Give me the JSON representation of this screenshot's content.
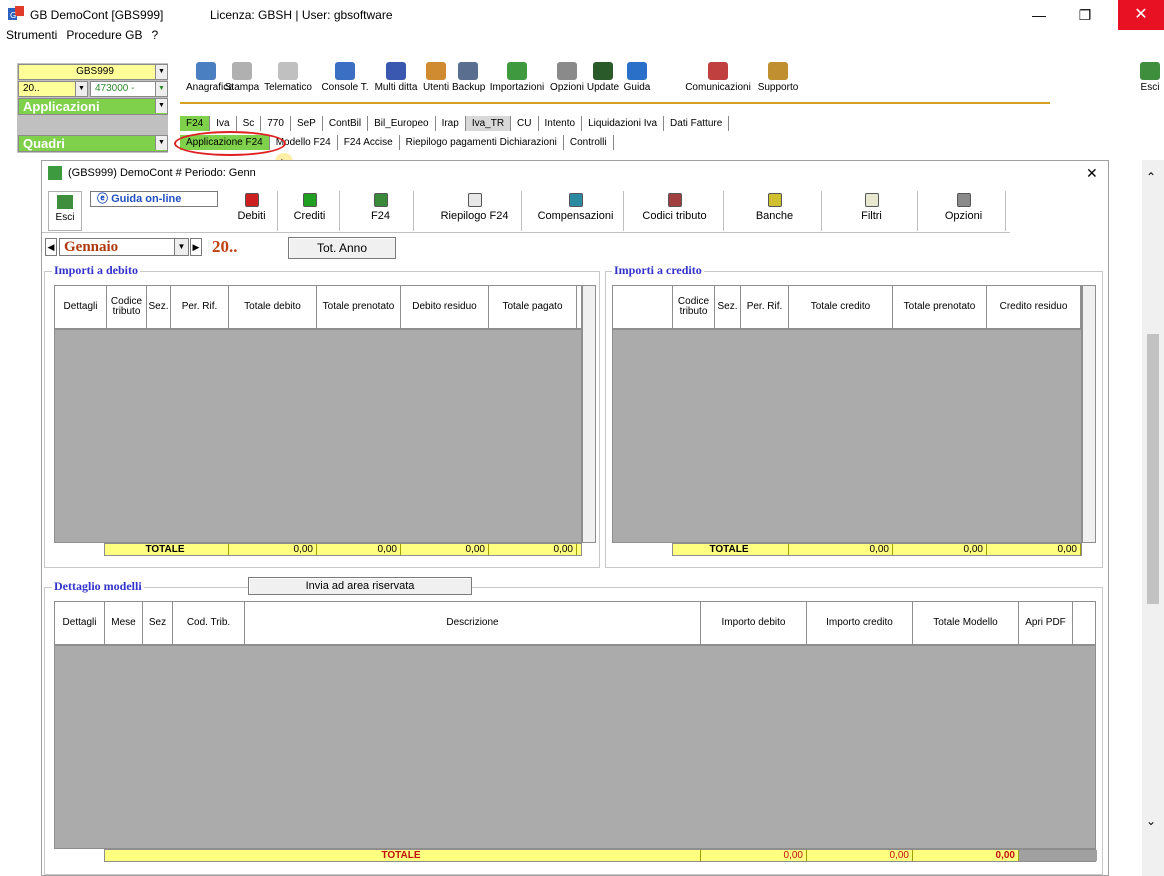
{
  "window": {
    "title": "GB DemoCont [GBS999]",
    "license": "Licenza: GBSH | User: gbsoftware",
    "min_glyph": "—",
    "max_glyph": "❐",
    "close_glyph": "✕"
  },
  "menu": [
    "Strumenti",
    "Procedure GB",
    "?"
  ],
  "left_panel": {
    "company_code": "GBS999",
    "year_value": "20..",
    "account_value": "473000 -",
    "applicazioni_label": "Applicazioni",
    "quadri_label": "Quadri"
  },
  "toolbar": [
    {
      "label": "Anagrafica",
      "icon": "anagrafica-icon",
      "color": "#4a7fc1"
    },
    {
      "label": "Stampa",
      "icon": "printer-icon",
      "color": "#b0b0b0"
    },
    {
      "label": "Telematico",
      "icon": "telematico-icon",
      "color": "#c0c0c0"
    },
    {
      "label": "Console T.",
      "icon": "console-icon",
      "color": "#3b6fc4"
    },
    {
      "label": "Multi ditta",
      "icon": "multiditta-icon",
      "color": "#3a58b0"
    },
    {
      "label": "Utenti",
      "icon": "users-icon",
      "color": "#d08a30"
    },
    {
      "label": "Backup",
      "icon": "backup-icon",
      "color": "#5a6f90"
    },
    {
      "label": "Importazioni",
      "icon": "import-icon",
      "color": "#3f9a3f"
    },
    {
      "label": "Opzioni",
      "icon": "wrench-icon",
      "color": "#8a8a8a"
    },
    {
      "label": "Update",
      "icon": "update-icon",
      "color": "#2a5a2a"
    },
    {
      "label": "Guida",
      "icon": "help-icon",
      "color": "#2a70c8"
    },
    {
      "label": "Comunicazioni",
      "icon": "comunicazioni-icon",
      "color": "#c04040"
    },
    {
      "label": "Supporto",
      "icon": "supporto-icon",
      "color": "#c09030"
    }
  ],
  "toolbar_exit": {
    "label": "Esci",
    "icon": "exit-icon"
  },
  "tabs_main": [
    "F24",
    "Iva",
    "Sc",
    "770",
    "SeP",
    "ContBil",
    "Bil_Europeo",
    "Irap",
    "Iva_TR",
    "CU",
    "Intento",
    "Liquidazioni Iva",
    "Dati Fatture"
  ],
  "tabs_sub": [
    "Applicazione F24",
    "Modello F24",
    "F24 Accise",
    "Riepilogo pagamenti Dichiarazioni",
    "Controlli"
  ],
  "child": {
    "title": "(GBS999) DemoCont  # Periodo: Genn",
    "close_glyph": "✕",
    "exit_label": "Esci",
    "guida_label": "Guida on-line",
    "toolbar": [
      {
        "label": "Debiti",
        "icon": "debiti-icon",
        "color": "#cc2020"
      },
      {
        "label": "Crediti",
        "icon": "crediti-icon",
        "color": "#20a020"
      },
      {
        "label": "F24",
        "icon": "f24-icon",
        "color": "#3a8a3a"
      },
      {
        "label": "Riepilogo F24",
        "icon": "riepilogo-icon",
        "color": "#e8e8e8"
      },
      {
        "label": "Compensazioni",
        "icon": "compensazioni-icon",
        "color": "#2a8aa0"
      },
      {
        "label": "Codici tributo",
        "icon": "codici-tributo-icon",
        "color": "#a04040"
      },
      {
        "label": "Banche",
        "icon": "banche-icon",
        "color": "#d0c030"
      },
      {
        "label": "Filtri",
        "icon": "filter-icon",
        "color": "#e8e8d0"
      },
      {
        "label": "Opzioni",
        "icon": "wrench-icon",
        "color": "#8a8a8a"
      }
    ],
    "period": {
      "month": "Gennaio",
      "year": "20..",
      "tot_anno_label": "Tot. Anno"
    },
    "debito": {
      "title": "Importi a debito",
      "columns": [
        "Dettagli",
        "Codice tributo",
        "Sez.",
        "Per. Rif.",
        "Totale debito",
        "Totale prenotato",
        "Debito residuo",
        "Totale pagato"
      ],
      "totals": {
        "label": "TOTALE",
        "values": [
          "0,00",
          "0,00",
          "0,00",
          "0,00"
        ]
      }
    },
    "credito": {
      "title": "Importi a credito",
      "columns": [
        "",
        "Codice tributo",
        "Sez.",
        "Per. Rif.",
        "Totale credito",
        "Totale prenotato",
        "Credito residuo"
      ],
      "totals": {
        "label": "TOTALE",
        "values": [
          "0,00",
          "0,00",
          "0,00"
        ]
      }
    },
    "modelli": {
      "title": "Dettaglio modelli",
      "send_button": "Invia ad area riservata",
      "columns": [
        "Dettagli",
        "Mese",
        "Sez",
        "Cod. Trib.",
        "Descrizione",
        "Importo debito",
        "Importo credito",
        "Totale Modello",
        "Apri PDF"
      ],
      "totals": {
        "label": "TOTALE",
        "values": [
          "0,00",
          "0,00",
          "0,00"
        ]
      }
    }
  }
}
